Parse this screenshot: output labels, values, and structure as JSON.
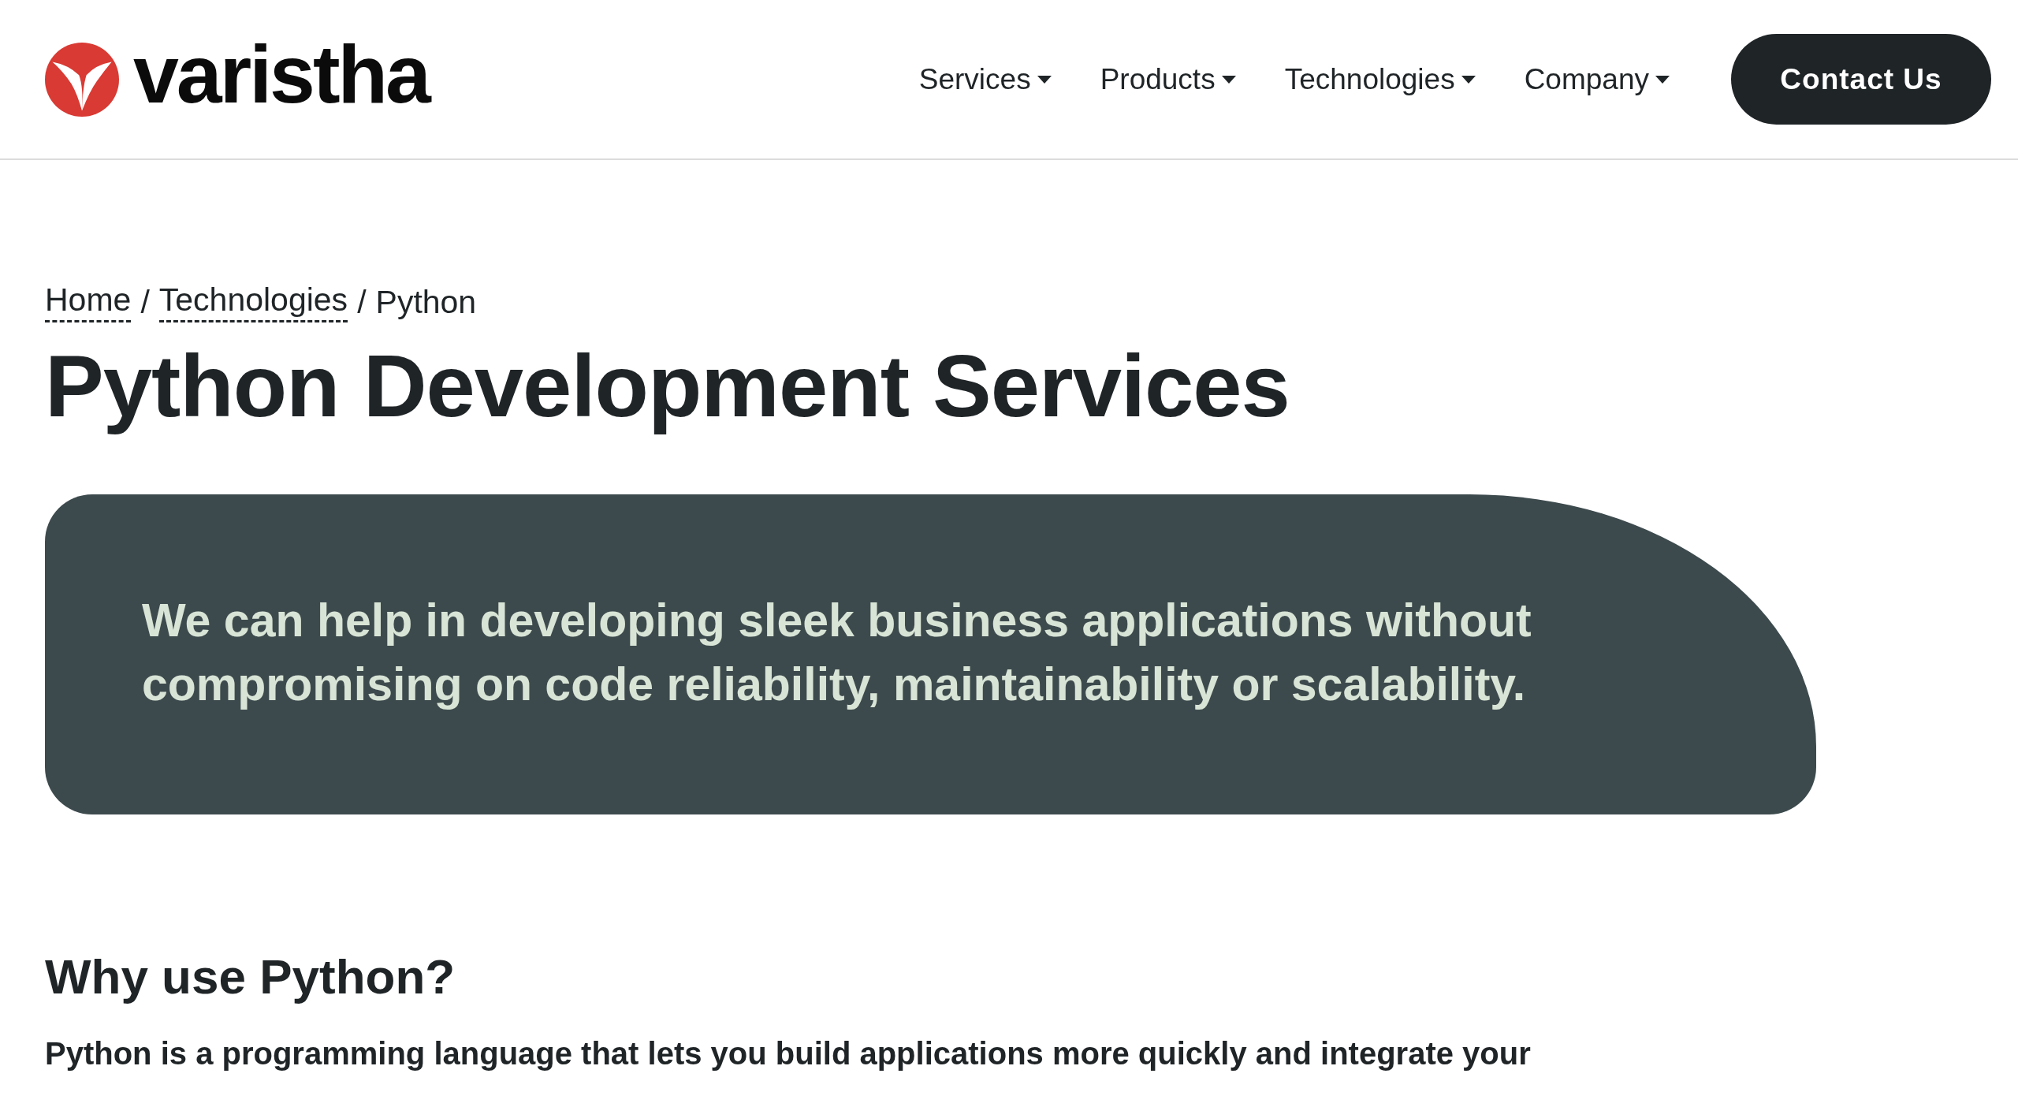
{
  "header": {
    "logo_text": "varistha",
    "nav": [
      {
        "label": "Services",
        "has_dropdown": true
      },
      {
        "label": "Products",
        "has_dropdown": true
      },
      {
        "label": "Technologies",
        "has_dropdown": true
      },
      {
        "label": "Company",
        "has_dropdown": true
      }
    ],
    "contact_button": "Contact Us"
  },
  "breadcrumb": [
    {
      "label": "Home",
      "link": true
    },
    {
      "label": "Technologies",
      "link": true
    },
    {
      "label": "Python",
      "link": false
    }
  ],
  "breadcrumb_separator": "/",
  "title": "Python Development Services",
  "banner": "We can help in developing sleek business applications without compromising on code reliability, maintainability or scalability.",
  "section": {
    "heading": "Why use Python?",
    "text": "Python is a programming language that lets you build applications more quickly and integrate your"
  }
}
